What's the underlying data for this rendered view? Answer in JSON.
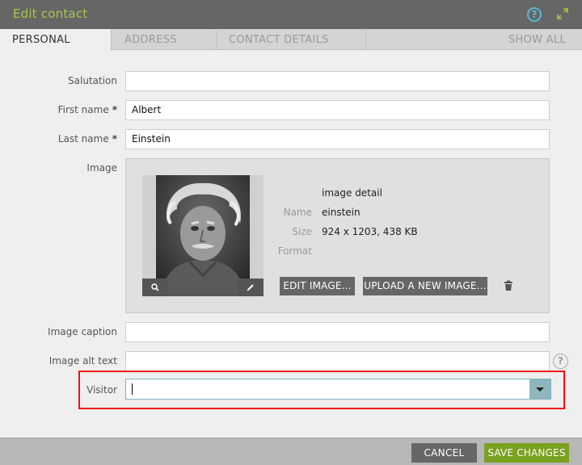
{
  "dialog": {
    "title": "Edit contact",
    "help_glyph": "?",
    "header_icons": [
      "help-icon",
      "expand-icon"
    ]
  },
  "tabs": [
    {
      "label": "PERSONAL",
      "active": true
    },
    {
      "label": "ADDRESS",
      "active": false
    },
    {
      "label": "CONTACT DETAILS",
      "active": false
    },
    {
      "label": "SHOW ALL",
      "active": false
    }
  ],
  "form": {
    "salutation": {
      "label": "Salutation",
      "value": ""
    },
    "first_name": {
      "label": "First name",
      "required_mark": "*",
      "value": "Albert"
    },
    "last_name": {
      "label": "Last name",
      "required_mark": "*",
      "value": "Einstein"
    },
    "image": {
      "label": "Image",
      "detail_heading": "image detail",
      "name_label": "Name",
      "name_value": "einstein",
      "size_label": "Size",
      "size_value": "924 x 1203, 438 KB",
      "format_label": "Format",
      "format_value": "",
      "edit_button": "EDIT IMAGE...",
      "upload_button": "UPLOAD A NEW IMAGE...",
      "icons": [
        "search-icon",
        "pencil-icon",
        "trash-icon"
      ]
    },
    "image_caption": {
      "label": "Image caption",
      "value": ""
    },
    "image_alt_text": {
      "label": "Image alt text",
      "value": "",
      "help_glyph": "?"
    },
    "visitor": {
      "label": "Visitor",
      "value": ""
    }
  },
  "footer": {
    "cancel": "CANCEL",
    "save": "SAVE CHANGES"
  },
  "colors": {
    "header_bg": "#666666",
    "title": "#a8c844",
    "help_accent": "#5ab7d6",
    "save_button": "#7aa11f",
    "highlight_border": "#ee1111"
  }
}
